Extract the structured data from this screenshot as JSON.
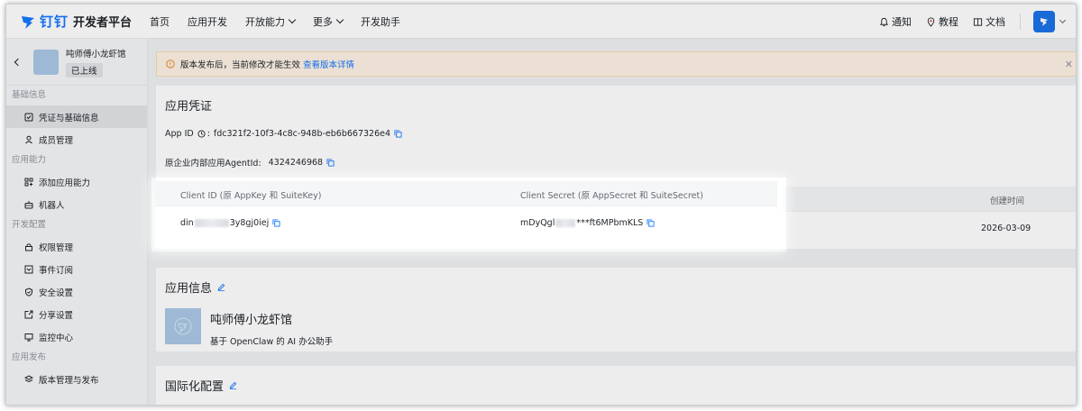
{
  "topbar": {
    "logo_text": "钉钉",
    "platform_name": "开发者平台",
    "nav": [
      {
        "label": "首页"
      },
      {
        "label": "应用开发"
      },
      {
        "label": "开放能力"
      },
      {
        "label": "更多"
      },
      {
        "label": "开发助手"
      }
    ],
    "right": {
      "notify": "通知",
      "tutorial": "教程",
      "docs": "文档"
    }
  },
  "sidebar": {
    "app_name": "吨师傅小龙虾馆",
    "app_status": "已上线",
    "sections": [
      {
        "title": "基础信息",
        "items": [
          {
            "label": "凭证与基础信息",
            "icon": "credential-icon",
            "active": true
          },
          {
            "label": "成员管理",
            "icon": "user-icon"
          }
        ]
      },
      {
        "title": "应用能力",
        "items": [
          {
            "label": "添加应用能力",
            "icon": "grid-add-icon"
          },
          {
            "label": "机器人",
            "icon": "robot-icon"
          }
        ]
      },
      {
        "title": "开发配置",
        "items": [
          {
            "label": "权限管理",
            "icon": "lock-icon"
          },
          {
            "label": "事件订阅",
            "icon": "event-icon"
          },
          {
            "label": "安全设置",
            "icon": "shield-icon"
          },
          {
            "label": "分享设置",
            "icon": "share-icon"
          },
          {
            "label": "监控中心",
            "icon": "monitor-icon"
          }
        ]
      },
      {
        "title": "应用发布",
        "items": [
          {
            "label": "版本管理与发布",
            "icon": "layers-icon"
          }
        ]
      }
    ]
  },
  "notice": {
    "text": "版本发布后，当前修改才能生效",
    "link": "查看版本详情"
  },
  "credentials": {
    "title": "应用凭证",
    "app_id_label": "App ID",
    "app_id_value": "fdc321f2-10f3-4c8c-948b-eb6b667326e4",
    "agent_label": "原企业内部应用AgentId:",
    "agent_value": "4324246968",
    "table": {
      "headers": [
        "Client ID (原 AppKey 和 SuiteKey)",
        "Client Secret (原 AppSecret 和 SuiteSecret)",
        "创建时间"
      ],
      "row": {
        "client_id_prefix": "din",
        "client_id_suffix": "3y8gj0iej",
        "secret_prefix": "mDyQgl",
        "secret_suffix": "***ft6MPbmKLS",
        "created": "2026-03-09"
      }
    }
  },
  "app_info": {
    "title": "应用信息",
    "name": "吨师傅小龙虾馆",
    "desc": "基于 OpenClaw 的 AI 办公助手"
  },
  "i18n": {
    "title": "国际化配置"
  },
  "colors": {
    "brand": "#1677ff",
    "notice_bg": "#fdf1e3"
  }
}
